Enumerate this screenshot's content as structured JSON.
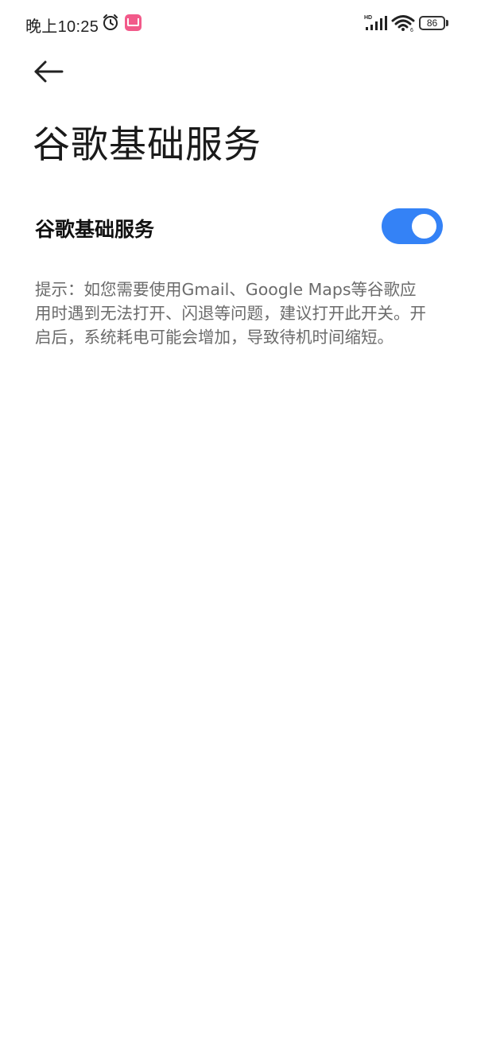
{
  "status_bar": {
    "time": "晚上10:25",
    "battery_level": "86",
    "icons": [
      "alarm-icon",
      "app-icon",
      "hd-signal-icon",
      "wifi-icon",
      "battery-icon"
    ]
  },
  "header": {
    "back_icon": "arrow-left-icon",
    "title": "谷歌基础服务"
  },
  "setting": {
    "label": "谷歌基础服务",
    "toggle_on": true,
    "toggle_color": "#3482f6"
  },
  "hint": {
    "text": "提示：如您需要使用Gmail、Google Maps等谷歌应用时遇到无法打开、闪退等问题，建议打开此开关。开启后，系统耗电可能会增加，导致待机时间缩短。"
  }
}
